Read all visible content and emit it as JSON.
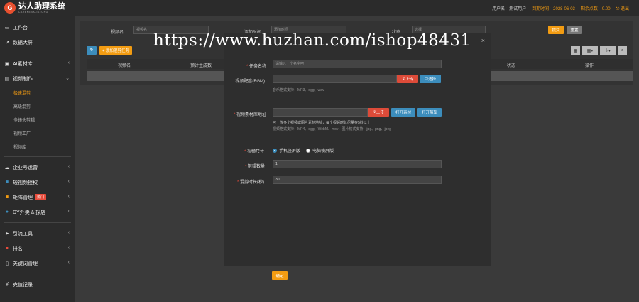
{
  "header": {
    "logo_glyph": "G",
    "title": "达人助理系统",
    "subtitle": "CAREKEBALISTONG",
    "user_label": "用户名：测试用户",
    "expiry_label": "到期时间：2028-06-03",
    "balance_label": "剩余点数：0.00",
    "logout_label": "退出"
  },
  "sidebar": {
    "items": [
      {
        "label": "工作台",
        "icon": "desktop-icon"
      },
      {
        "label": "数据大屏",
        "icon": "chart-icon"
      },
      {
        "label": "AI素材库",
        "icon": "folder-icon"
      },
      {
        "label": "视频制作",
        "icon": "film-icon"
      }
    ],
    "sub_items": [
      "极速混剪",
      "高级混剪",
      "多镜头剪辑",
      "视频工厂",
      "视频库"
    ],
    "items2": [
      {
        "label": "企业号运营",
        "icon": "cloud-icon"
      },
      {
        "label": "短视频授权",
        "icon": "grid-icon"
      },
      {
        "label": "矩阵管理",
        "icon": "folder-icon",
        "badge": "热门"
      },
      {
        "label": "DY外卖 & 探店",
        "icon": "globe-icon"
      },
      {
        "label": "引流工具",
        "icon": "send-icon"
      },
      {
        "label": "排名",
        "icon": "weibo-icon"
      },
      {
        "label": "关键词管理",
        "icon": "file-icon"
      },
      {
        "label": "充值记录",
        "icon": "yen-icon"
      }
    ]
  },
  "filters": {
    "name_label": "视频名",
    "name_placeholder": "视频名",
    "time_label": "添加时间",
    "time_placeholder": "添加时间",
    "status_label": "状态",
    "status_value": "选择",
    "submit_label": "提交",
    "reset_label": "重置"
  },
  "toolbar": {
    "refresh_icon": "refresh-icon",
    "add_label": "+ 添加混剪任务"
  },
  "table": {
    "headers": [
      "视频名",
      "预计生成数",
      "状态",
      "操作"
    ]
  },
  "modal": {
    "close_glyph": "×",
    "task_name_label": "任务名称",
    "task_name_placeholder": "请输入一个名字吧",
    "bgm_label": "视频配音(BGM)",
    "upload_label": "上传",
    "choose_label": "选择",
    "bgm_hint": "音乐格式支持：MP3、ogg、wav",
    "material_label": "视频素材库地址",
    "upload2_label": "上传",
    "open_material_label": "打开素材",
    "open_clip_label": "打开剪辑",
    "material_hint1": "可上传多个视频或图片素材地址，每个视频时长尽量在5秒以上",
    "material_hint2": "视频格式支持：MP4、ogg、WebM、mov；图片格式支持：jpg、png、jpeg",
    "size_label": "视频尺寸",
    "size_option1": "手机竖屏版",
    "size_option2": "电脑横屏版",
    "count_label": "剪辑数量",
    "count_value": "1",
    "duration_label": "混剪时长(秒)",
    "duration_value": "30",
    "confirm_label": "确定"
  },
  "watermark": "https://www.huzhan.com/ishop48431"
}
